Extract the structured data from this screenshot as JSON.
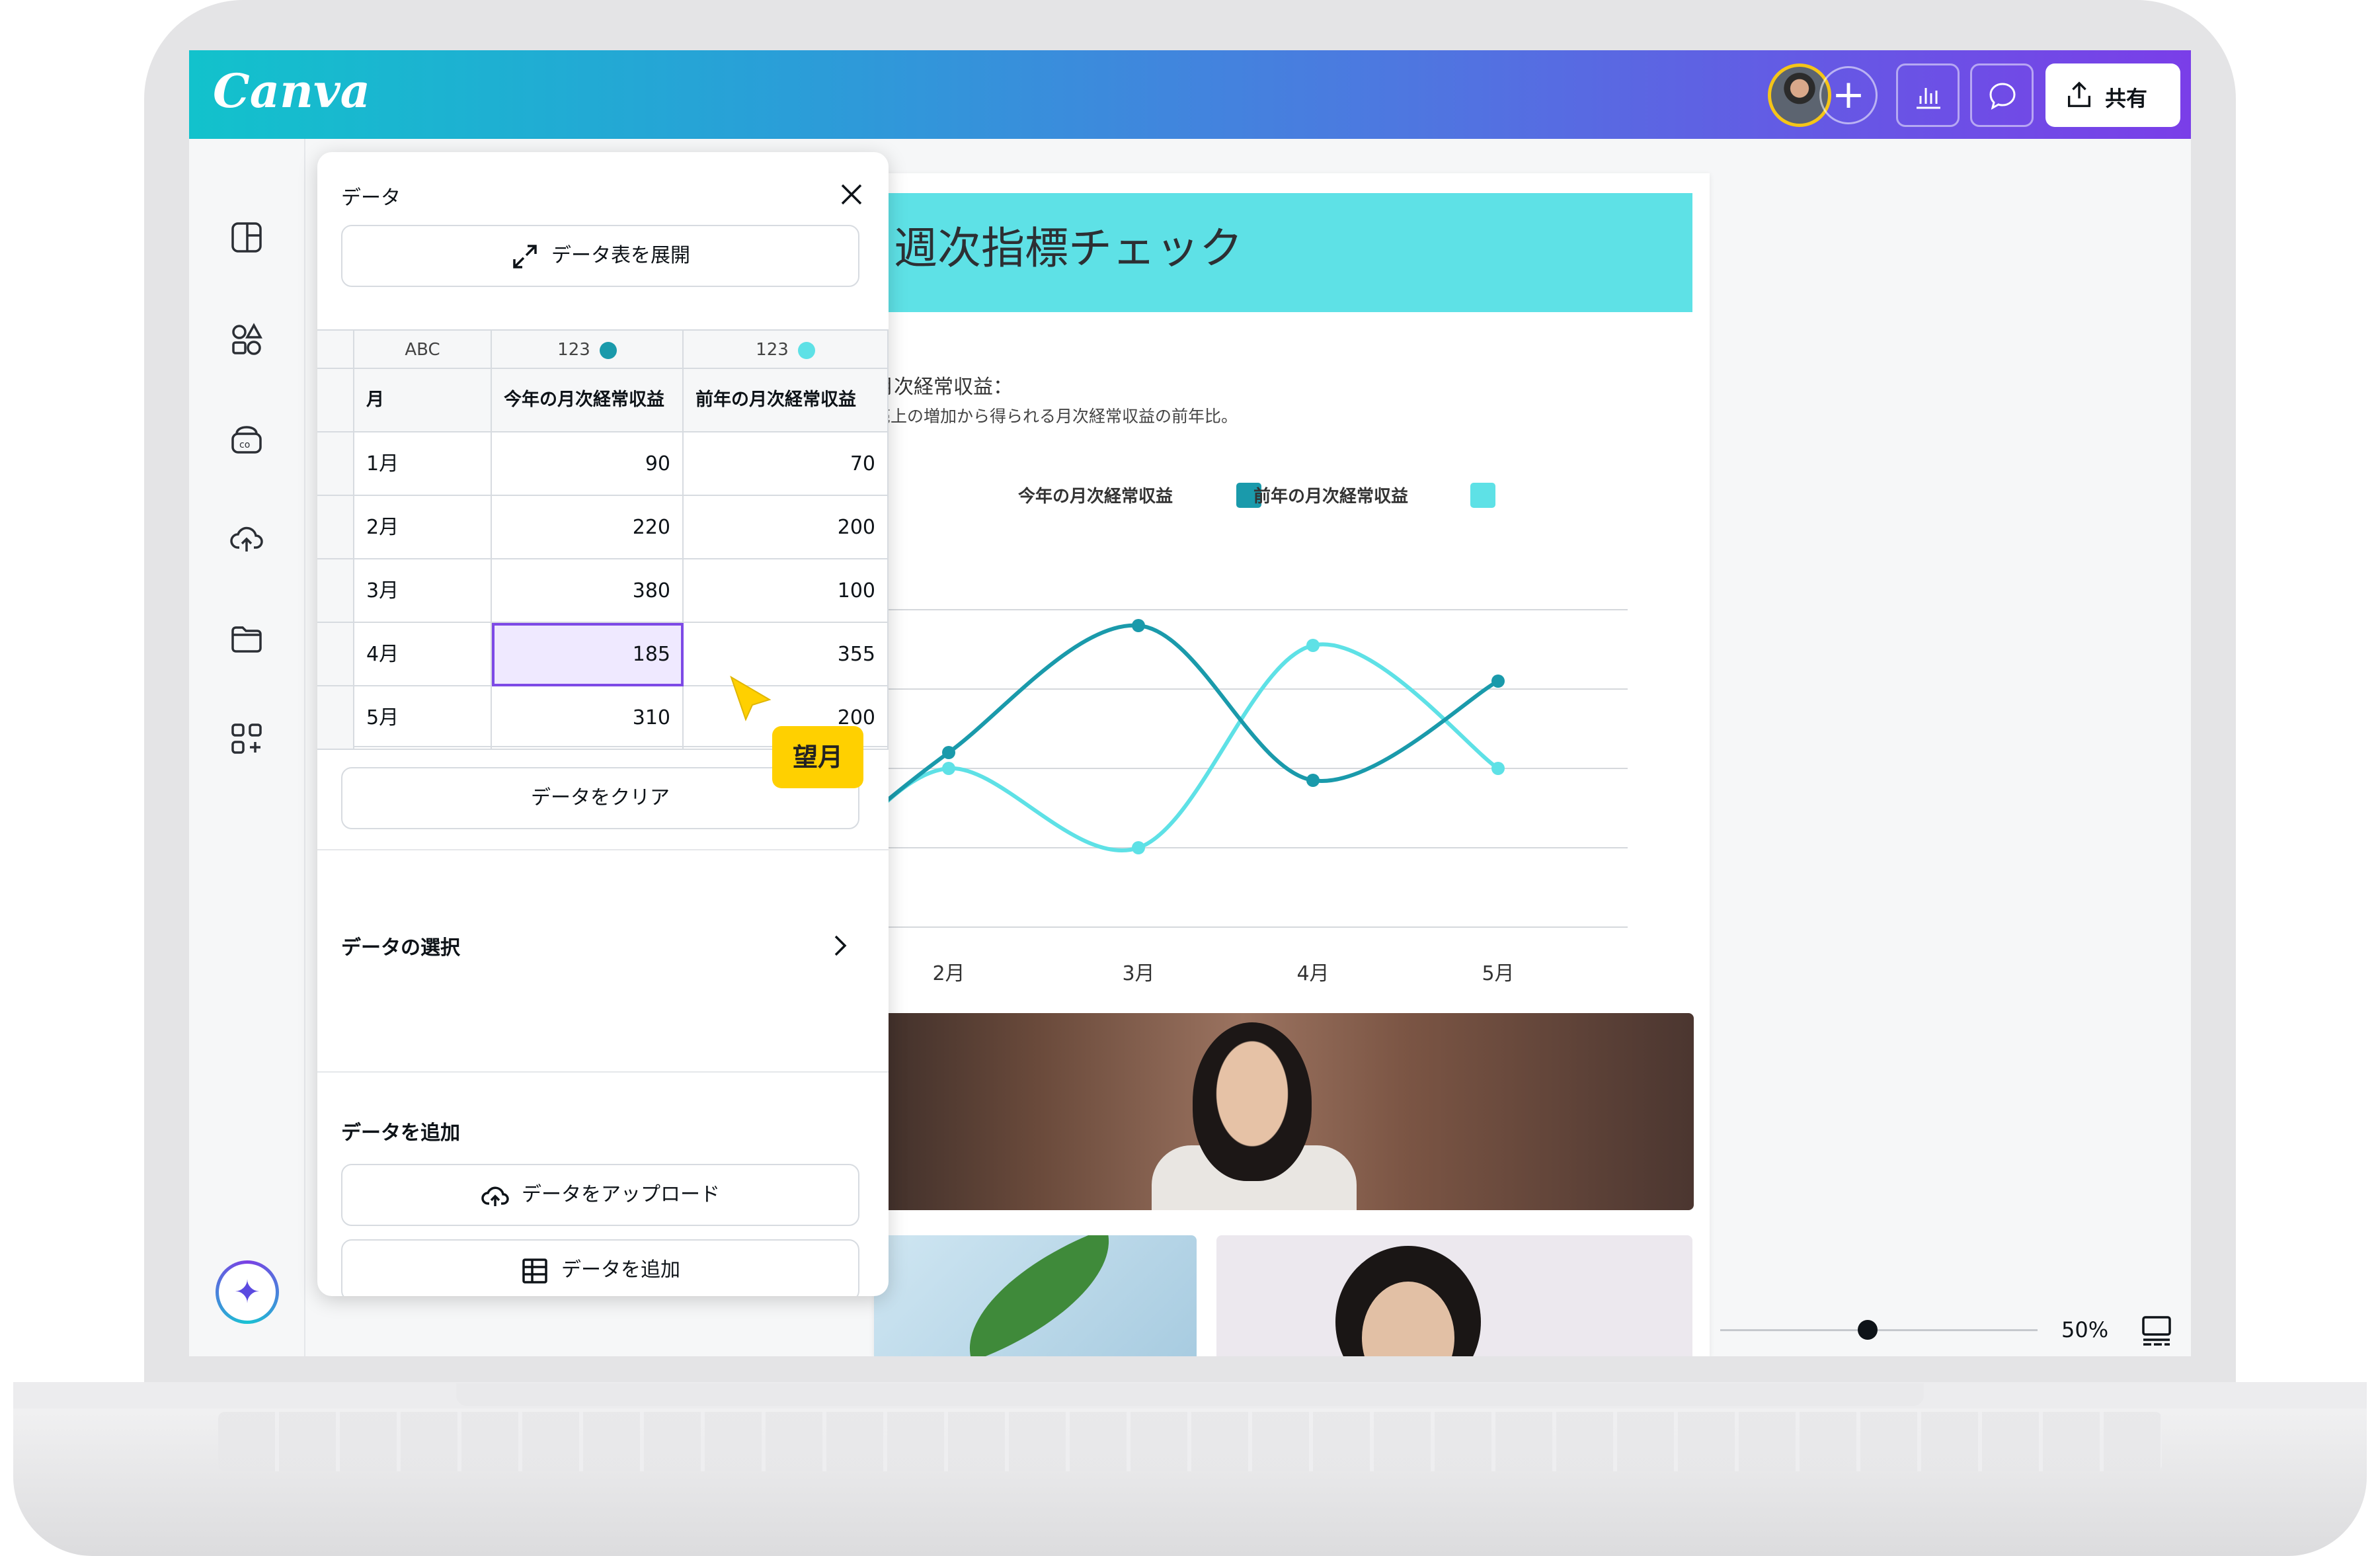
{
  "app": {
    "logo": "Canva"
  },
  "header": {
    "share_label": "共有"
  },
  "design": {
    "title": "週次指標チェック",
    "subtitle": "月次経常収益：",
    "description": "売上の増加から得られる月次経常収益の前年比。"
  },
  "panel": {
    "title": "データ",
    "expand_button": "データ表を展開",
    "columns": [
      {
        "type": "ABC",
        "name": "月"
      },
      {
        "type": "123",
        "name": "今年の月次経常収益",
        "color": "#1a9aab"
      },
      {
        "type": "123",
        "name": "前年の月次経常収益",
        "color": "#5ee1e6"
      }
    ],
    "rows": [
      {
        "month": "1月",
        "this_year": "90",
        "last_year": "70"
      },
      {
        "month": "2月",
        "this_year": "220",
        "last_year": "200"
      },
      {
        "month": "3月",
        "this_year": "380",
        "last_year": "100"
      },
      {
        "month": "4月",
        "this_year": "185",
        "last_year": "355"
      },
      {
        "month": "5月",
        "this_year": "310",
        "last_year": "200"
      }
    ],
    "selected_cell": "185",
    "collaborator_tag": "望月",
    "clear_button": "データをクリア",
    "select_section": "データの選択",
    "add_section": "データを追加",
    "upload_button": "データをアップロード",
    "add_button": "データを追加"
  },
  "chart_data": {
    "type": "line",
    "categories": [
      "1月",
      "2月",
      "3月",
      "4月",
      "5月"
    ],
    "series": [
      {
        "name": "今年の月次経常収益",
        "values": [
          90,
          220,
          380,
          185,
          310
        ],
        "color": "#1a9aab"
      },
      {
        "name": "前年の月次経常収益",
        "values": [
          70,
          200,
          100,
          355,
          200
        ],
        "color": "#5ee1e6"
      }
    ],
    "legend": "top",
    "grid": true
  },
  "zoom": {
    "label": "50%",
    "level": 0.5
  }
}
